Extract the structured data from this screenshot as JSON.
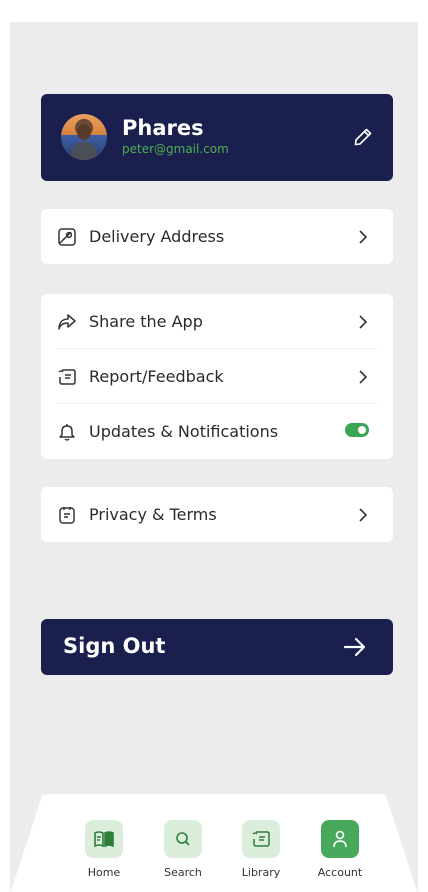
{
  "profile": {
    "name": "Phares",
    "email": "peter@gmail.com"
  },
  "menu_groups": [
    {
      "items": [
        {
          "label": "Delivery Address",
          "icon": "map-icon",
          "trailing": "chevron"
        }
      ]
    },
    {
      "items": [
        {
          "label": "Share the App",
          "icon": "share-icon",
          "trailing": "chevron"
        },
        {
          "label": "Report/Feedback",
          "icon": "feedback-icon",
          "trailing": "chevron"
        },
        {
          "label": "Updates & Notifications",
          "icon": "bell-icon",
          "trailing": "toggle",
          "toggle_on": true
        }
      ]
    },
    {
      "items": [
        {
          "label": "Privacy & Terms",
          "icon": "document-icon",
          "trailing": "chevron"
        }
      ]
    }
  ],
  "signout": {
    "label": "Sign Out"
  },
  "nav": {
    "active": "Account",
    "items": [
      {
        "label": "Home",
        "icon": "book-icon"
      },
      {
        "label": "Search",
        "icon": "search-icon"
      },
      {
        "label": "Library",
        "icon": "library-icon"
      },
      {
        "label": "Account",
        "icon": "user-icon"
      }
    ]
  },
  "colors": {
    "navy": "#1a1f4e",
    "green": "#48a95c",
    "accent_text": "#4caf50",
    "background": "#ececec"
  }
}
